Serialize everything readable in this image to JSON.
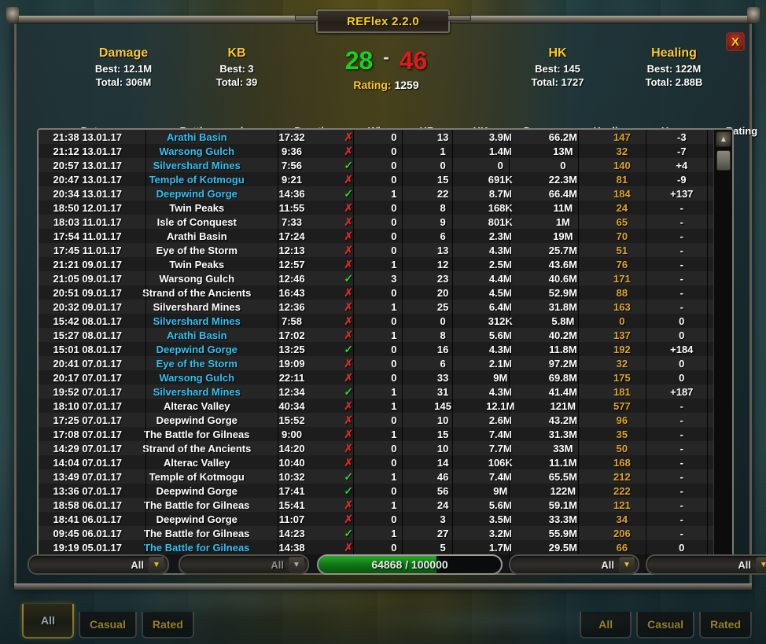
{
  "window": {
    "title": "REFlex 2.2.0",
    "close_label": "X"
  },
  "colors": {
    "accent_gold": "#ffc926",
    "honor": "#e0a526",
    "win_green": "#27d427",
    "loss_red": "#d32a22",
    "rated_blue": "#2fc3f5"
  },
  "stats": {
    "damage": {
      "title": "Damage",
      "best_label": "Best: 12.1M",
      "total_label": "Total: 306M"
    },
    "kb": {
      "title": "KB",
      "best_label": "Best: 3",
      "total_label": "Total: 39"
    },
    "hk": {
      "title": "HK",
      "best_label": "Best: 145",
      "total_label": "Total: 1727"
    },
    "healing": {
      "title": "Healing",
      "best_label": "Best: 122M",
      "total_label": "Total: 2.88B"
    }
  },
  "score": {
    "wins": "28",
    "dash": "-",
    "losses": "46",
    "rating_label": "Rating:",
    "rating_value": "1259"
  },
  "table": {
    "headers": [
      "Date",
      "Battleground",
      "Duration",
      "Win",
      "KB",
      "HK",
      "Damage",
      "Healing",
      "Honor",
      "Rating"
    ],
    "rows": [
      {
        "date": "21:38 13.01.17",
        "bg": "Arathi Basin",
        "rated": true,
        "dur": "17:32",
        "win": false,
        "kb": "0",
        "hk": "13",
        "dmg": "3.9M",
        "heal": "66.2M",
        "honor": "147",
        "rating": "-3",
        "rt": "neg"
      },
      {
        "date": "21:12 13.01.17",
        "bg": "Warsong Gulch",
        "rated": true,
        "dur": "9:36",
        "win": false,
        "kb": "0",
        "hk": "1",
        "dmg": "1.4M",
        "heal": "13M",
        "honor": "32",
        "rating": "-7",
        "rt": "neg"
      },
      {
        "date": "20:57 13.01.17",
        "bg": "Silvershard Mines",
        "rated": true,
        "dur": "7:56",
        "win": true,
        "kb": "0",
        "hk": "0",
        "dmg": "0",
        "heal": "0",
        "honor": "140",
        "rating": "+4",
        "rt": "pos"
      },
      {
        "date": "20:47 13.01.17",
        "bg": "Temple of Kotmogu",
        "rated": true,
        "dur": "9:21",
        "win": false,
        "kb": "0",
        "hk": "15",
        "dmg": "691K",
        "heal": "22.3M",
        "honor": "81",
        "rating": "-9",
        "rt": "neg"
      },
      {
        "date": "20:34 13.01.17",
        "bg": "Deepwind Gorge",
        "rated": true,
        "dur": "14:36",
        "win": true,
        "kb": "1",
        "hk": "22",
        "dmg": "8.7M",
        "heal": "66.4M",
        "honor": "184",
        "rating": "+137",
        "rt": "pos"
      },
      {
        "date": "18:50 12.01.17",
        "bg": "Twin Peaks",
        "rated": false,
        "dur": "11:55",
        "win": false,
        "kb": "0",
        "hk": "8",
        "dmg": "168K",
        "heal": "11M",
        "honor": "24",
        "rating": "-",
        "rt": "neutral"
      },
      {
        "date": "18:03 11.01.17",
        "bg": "Isle of Conquest",
        "rated": false,
        "dur": "7:33",
        "win": false,
        "kb": "0",
        "hk": "9",
        "dmg": "801K",
        "heal": "1M",
        "honor": "65",
        "rating": "-",
        "rt": "neutral"
      },
      {
        "date": "17:54 11.01.17",
        "bg": "Arathi Basin",
        "rated": false,
        "dur": "17:24",
        "win": false,
        "kb": "0",
        "hk": "6",
        "dmg": "2.3M",
        "heal": "19M",
        "honor": "70",
        "rating": "-",
        "rt": "neutral"
      },
      {
        "date": "17:45 11.01.17",
        "bg": "Eye of the Storm",
        "rated": false,
        "dur": "12:13",
        "win": false,
        "kb": "0",
        "hk": "13",
        "dmg": "4.3M",
        "heal": "25.7M",
        "honor": "51",
        "rating": "-",
        "rt": "neutral"
      },
      {
        "date": "21:21 09.01.17",
        "bg": "Twin Peaks",
        "rated": false,
        "dur": "12:57",
        "win": false,
        "kb": "1",
        "hk": "12",
        "dmg": "2.5M",
        "heal": "43.6M",
        "honor": "76",
        "rating": "-",
        "rt": "neutral"
      },
      {
        "date": "21:05 09.01.17",
        "bg": "Warsong Gulch",
        "rated": false,
        "dur": "12:46",
        "win": true,
        "kb": "3",
        "hk": "23",
        "dmg": "4.4M",
        "heal": "40.6M",
        "honor": "171",
        "rating": "-",
        "rt": "neutral"
      },
      {
        "date": "20:51 09.01.17",
        "bg": "Strand of the Ancients",
        "rated": false,
        "dur": "16:43",
        "win": false,
        "kb": "0",
        "hk": "20",
        "dmg": "4.5M",
        "heal": "52.9M",
        "honor": "88",
        "rating": "-",
        "rt": "neutral"
      },
      {
        "date": "20:32 09.01.17",
        "bg": "Silvershard Mines",
        "rated": false,
        "dur": "12:36",
        "win": false,
        "kb": "1",
        "hk": "25",
        "dmg": "6.4M",
        "heal": "31.8M",
        "honor": "163",
        "rating": "-",
        "rt": "neutral"
      },
      {
        "date": "15:42 08.01.17",
        "bg": "Silvershard Mines",
        "rated": true,
        "dur": "7:58",
        "win": false,
        "kb": "0",
        "hk": "0",
        "dmg": "312K",
        "heal": "5.8M",
        "honor": "0",
        "rating": "0",
        "rt": "neutral"
      },
      {
        "date": "15:27 08.01.17",
        "bg": "Arathi Basin",
        "rated": true,
        "dur": "17:02",
        "win": false,
        "kb": "1",
        "hk": "8",
        "dmg": "5.6M",
        "heal": "40.2M",
        "honor": "137",
        "rating": "0",
        "rt": "neutral"
      },
      {
        "date": "15:01 08.01.17",
        "bg": "Deepwind Gorge",
        "rated": true,
        "dur": "13:25",
        "win": true,
        "kb": "0",
        "hk": "16",
        "dmg": "4.3M",
        "heal": "11.8M",
        "honor": "192",
        "rating": "+184",
        "rt": "pos"
      },
      {
        "date": "20:41 07.01.17",
        "bg": "Eye of the Storm",
        "rated": true,
        "dur": "19:09",
        "win": false,
        "kb": "0",
        "hk": "6",
        "dmg": "2.1M",
        "heal": "97.2M",
        "honor": "32",
        "rating": "0",
        "rt": "neutral"
      },
      {
        "date": "20:17 07.01.17",
        "bg": "Warsong Gulch",
        "rated": true,
        "dur": "22:11",
        "win": false,
        "kb": "0",
        "hk": "33",
        "dmg": "9M",
        "heal": "69.8M",
        "honor": "175",
        "rating": "0",
        "rt": "neutral"
      },
      {
        "date": "19:52 07.01.17",
        "bg": "Silvershard Mines",
        "rated": true,
        "dur": "12:34",
        "win": true,
        "kb": "1",
        "hk": "31",
        "dmg": "4.3M",
        "heal": "41.4M",
        "honor": "181",
        "rating": "+187",
        "rt": "pos"
      },
      {
        "date": "18:10 07.01.17",
        "bg": "Alterac Valley",
        "rated": false,
        "dur": "40:34",
        "win": false,
        "kb": "1",
        "hk": "145",
        "dmg": "12.1M",
        "heal": "121M",
        "honor": "577",
        "rating": "-",
        "rt": "neutral"
      },
      {
        "date": "17:25 07.01.17",
        "bg": "Deepwind Gorge",
        "rated": false,
        "dur": "15:52",
        "win": false,
        "kb": "0",
        "hk": "10",
        "dmg": "2.6M",
        "heal": "43.2M",
        "honor": "96",
        "rating": "-",
        "rt": "neutral"
      },
      {
        "date": "17:08 07.01.17",
        "bg": "The Battle for Gilneas",
        "rated": false,
        "dur": "9:00",
        "win": false,
        "kb": "1",
        "hk": "15",
        "dmg": "7.4M",
        "heal": "31.3M",
        "honor": "35",
        "rating": "-",
        "rt": "neutral"
      },
      {
        "date": "14:29 07.01.17",
        "bg": "Strand of the Ancients",
        "rated": false,
        "dur": "14:20",
        "win": false,
        "kb": "0",
        "hk": "10",
        "dmg": "7.7M",
        "heal": "33M",
        "honor": "50",
        "rating": "-",
        "rt": "neutral"
      },
      {
        "date": "14:04 07.01.17",
        "bg": "Alterac Valley",
        "rated": false,
        "dur": "10:40",
        "win": false,
        "kb": "0",
        "hk": "14",
        "dmg": "106K",
        "heal": "11.1M",
        "honor": "168",
        "rating": "-",
        "rt": "neutral"
      },
      {
        "date": "13:49 07.01.17",
        "bg": "Temple of Kotmogu",
        "rated": false,
        "dur": "10:32",
        "win": true,
        "kb": "1",
        "hk": "46",
        "dmg": "7.4M",
        "heal": "65.5M",
        "honor": "212",
        "rating": "-",
        "rt": "neutral"
      },
      {
        "date": "13:36 07.01.17",
        "bg": "Deepwind Gorge",
        "rated": false,
        "dur": "17:41",
        "win": true,
        "kb": "0",
        "hk": "56",
        "dmg": "9M",
        "heal": "122M",
        "honor": "222",
        "rating": "-",
        "rt": "neutral"
      },
      {
        "date": "18:58 06.01.17",
        "bg": "The Battle for Gilneas",
        "rated": false,
        "dur": "15:41",
        "win": false,
        "kb": "1",
        "hk": "24",
        "dmg": "5.6M",
        "heal": "59.1M",
        "honor": "121",
        "rating": "-",
        "rt": "neutral"
      },
      {
        "date": "18:41 06.01.17",
        "bg": "Deepwind Gorge",
        "rated": false,
        "dur": "11:07",
        "win": false,
        "kb": "0",
        "hk": "3",
        "dmg": "3.5M",
        "heal": "33.3M",
        "honor": "34",
        "rating": "-",
        "rt": "neutral"
      },
      {
        "date": "09:45 06.01.17",
        "bg": "The Battle for Gilneas",
        "rated": false,
        "dur": "14:23",
        "win": true,
        "kb": "1",
        "hk": "27",
        "dmg": "3.2M",
        "heal": "55.9M",
        "honor": "206",
        "rating": "-",
        "rt": "neutral"
      },
      {
        "date": "19:19 05.01.17",
        "bg": "The Battle for Gilneas",
        "rated": true,
        "dur": "14:38",
        "win": false,
        "kb": "0",
        "hk": "5",
        "dmg": "1.7M",
        "heal": "29.5M",
        "honor": "66",
        "rating": "0",
        "rt": "neutral"
      }
    ],
    "win_yes_glyph": "✓",
    "win_no_glyph": "✗"
  },
  "scrollbar": {
    "up_glyph": "▲",
    "down_glyph": "▼"
  },
  "filters": {
    "dropdown_1": {
      "value": "All",
      "arrow": "▼",
      "disabled": false
    },
    "dropdown_2": {
      "value": "All",
      "arrow": "▼",
      "disabled": true
    },
    "dropdown_3": {
      "value": "All",
      "arrow": "▼",
      "disabled": false
    },
    "dropdown_4": {
      "value": "All",
      "arrow": "▼",
      "disabled": false
    },
    "progress": {
      "text": "64868 / 100000",
      "current": 64868,
      "max": 100000,
      "percent": 64.868
    }
  },
  "tabs_left": [
    {
      "label": "All",
      "active": true
    },
    {
      "label": "Casual",
      "active": false
    },
    {
      "label": "Rated",
      "active": false
    }
  ],
  "tabs_right": [
    {
      "label": "All",
      "active": false
    },
    {
      "label": "Casual",
      "active": false
    },
    {
      "label": "Rated",
      "active": false
    }
  ]
}
